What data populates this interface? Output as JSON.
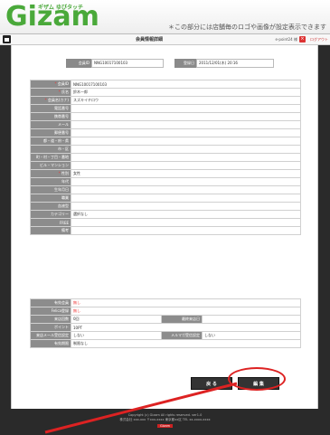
{
  "header": {
    "logo": "Gizam",
    "logo_sub": "ギザム ゆびタッチ",
    "notice": "＊この部分には店舗毎のロゴや画像が設定表示できます"
  },
  "nav": {
    "title": "会員情報詳細",
    "user": "e-point24 様",
    "logout": "ログアウト"
  },
  "idbar": {
    "member_id_label": "会員ID",
    "member_id_value": "NNG10017100103",
    "registered_label": "登録日",
    "registered_value": "2011/12/01(木) 20:16"
  },
  "fields": [
    {
      "label": "会員ID",
      "value": "NNG10017100103",
      "required": true
    },
    {
      "label": "氏名",
      "value": "鈴木一郎",
      "required": true
    },
    {
      "label": "会員名(カナ)",
      "value": "スズキイチロウ",
      "required": true
    },
    {
      "label": "電話番号",
      "value": ""
    },
    {
      "label": "携帯番号",
      "value": ""
    },
    {
      "label": "メール",
      "value": ""
    },
    {
      "label": "郵便番号",
      "value": ""
    },
    {
      "label": "都・道・府・県",
      "value": ""
    },
    {
      "label": "市・区",
      "value": ""
    },
    {
      "label": "町・村・丁目・番地",
      "value": ""
    },
    {
      "label": "ビル・マンション",
      "value": ""
    },
    {
      "label": "性別",
      "value": "女性",
      "required": true
    },
    {
      "label": "年代",
      "value": ""
    },
    {
      "label": "生年月日",
      "value": ""
    },
    {
      "label": "職業",
      "value": ""
    },
    {
      "label": "血液型",
      "value": ""
    },
    {
      "label": "カテゴリー",
      "value": "選択なし"
    },
    {
      "label": "FREE",
      "value": ""
    },
    {
      "label": "備考",
      "value": ""
    }
  ],
  "status": {
    "row1_label": "有効会員",
    "row1_value": "無し",
    "row2_label": "Felica登録",
    "row2_value": "無し",
    "row3_label": "来店回数",
    "row3_value": "0回",
    "row3_right_label": "最終来店日",
    "row3_right_value": "",
    "row4_label": "ポイント",
    "row4_value": "10PT",
    "row5_label": "来店メール受信設定",
    "row5_value": "しない",
    "row5_right_label": "メルマガ受信設定",
    "row5_right_value": "しない",
    "row6_label": "有効期限",
    "row6_value": "制限なし"
  },
  "buttons": {
    "back": "戻 る",
    "edit": "編 集"
  },
  "footer": {
    "line1": "Copyright (c) Gizam All rights reserved. ver1.0",
    "line2": "株式会社 xxx-xxx 〒xxx-xxxx 東京都xx区 TEL xx-xxxx-xxxx",
    "badge": "Gizam"
  },
  "colors": {
    "accent_red": "#dd2222",
    "label_bg": "#8c8c8c",
    "logo_green": "#4aa93a"
  }
}
